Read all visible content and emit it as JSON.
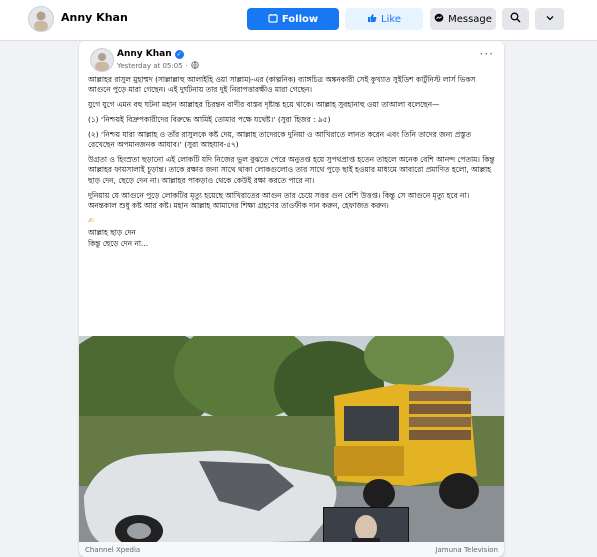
{
  "header": {
    "profile_name": "Anny Khan",
    "follow_label": "Follow",
    "like_label": "Like",
    "message_label": "Message",
    "search_icon": "search-icon",
    "more_icon": "more-icon"
  },
  "post": {
    "author": "Anny Khan",
    "verified": true,
    "timestamp": "Yesterday at 05:05",
    "privacy_icon": "globe-icon",
    "paragraphs": [
      "আল্লাহর রাসুল মুহাম্মদ (সাল্লাল্লাহু আলাইহি ওয়া সাল্লাম)-এর (কাল্পনিক) ব্যাঙ্গচিত্র অঙ্কনকারী সেই কুখ্যাত সুইডিশ কার্টুনিস্ট লার্স ভিকস আগুনে পুড়ে মারা গেছেন। এই দুর্ঘটনায় তার দুই নিরাপত্তারক্ষীও মারা গেছেন।",
      "যুগে যুগে এমন বহু ঘটনা মহান আল্লাহর চিরন্তন বাণীর বাস্তব দৃষ্টান্ত হয়ে থাকে। আল্লাহ সুবহানাহু ওয়া তাআলা বলেছেন—",
      "(১) ‘নিশ্চয়ই বিদ্রুপকারীদের বিরুদ্ধে আমিই তোমার পক্ষে যথেষ্ট।’ (সুরা হিজর : ৯৫)",
      "(২) ‘নিশ্চয় যারা আল্লাহ ও তাঁর রাসুলকে কষ্ট দেয়, আল্লাহ তাদেরকে দুনিয়া ও আখিরাতে লানত করেন এবং তিনি তাদের জন্য প্রস্তুত রেখেছেন অপমানজনক আযাব।’ (সুরা আহযাব-৫৭)",
      "উগ্রতা ও হিংস্রতা ছড়ানো এই লোকটি যদি নিজের ভুল বুঝতে পেরে অনুতপ্ত হয়ে সুপথপ্রাপ্ত হতেন তাহলে অনেক বেশি আনন্দ পেতাম। কিন্তু আল্লাহর ফায়সালাই চূড়ান্ত। তাকে রক্ষার জন্য সাথে থাকা লোকগুলোও তার সাথে পুড়ে ছাই হওয়ার মাধ্যমে আবারো প্রমাণিত হলো, আল্লাহ ছাড় দেন, ছেড়ে দেন না। আল্লাহর পাকড়াও থেকে কেউই রক্ষা করতে পারে না।",
      "দুনিয়ায় যে আগুনে পুড়ে লোকটির মৃত্যু হয়েছে আখিরাতের আগুন তার চেয়ে সত্তর গুন বেশি উত্তপ্ত। কিন্তু সে আগুনে মৃত্যু হবে না। অনন্তকাল শুধু কষ্ট আর কষ্ট। মহান আল্লাহ আমাদের শিক্ষা গ্রহণের তাওফীক দান করুন, হেফাজত করুন।",
      "✍",
      "আল্লাহ ছাড় দেন\nকিন্তু ছেড়ে দেন না..."
    ]
  },
  "media_bar": {
    "left_label": "Channel Xpedia",
    "right_label": "Jamuna Television"
  },
  "colors": {
    "accent": "#1877f2",
    "light_accent": "#e7f3ff",
    "page_bg": "#f0f2f5"
  }
}
